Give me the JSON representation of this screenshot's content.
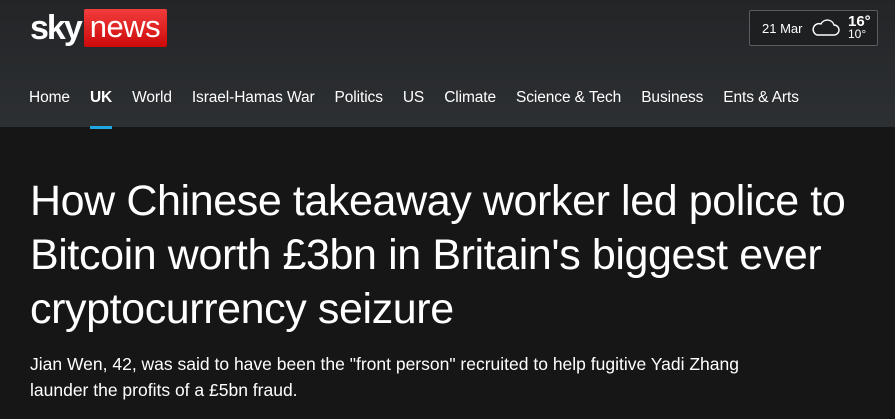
{
  "brand": {
    "logo_sky": "sky",
    "logo_news": "news",
    "accent_red": "#e31b1b",
    "accent_blue": "#1ea7e1"
  },
  "weather": {
    "date": "21 Mar",
    "icon": "cloud-icon",
    "high": "16°",
    "low": "10°"
  },
  "nav": {
    "items": [
      {
        "label": "Home",
        "active": false
      },
      {
        "label": "UK",
        "active": true
      },
      {
        "label": "World",
        "active": false
      },
      {
        "label": "Israel-Hamas War",
        "active": false
      },
      {
        "label": "Politics",
        "active": false
      },
      {
        "label": "US",
        "active": false
      },
      {
        "label": "Climate",
        "active": false
      },
      {
        "label": "Science & Tech",
        "active": false
      },
      {
        "label": "Business",
        "active": false
      },
      {
        "label": "Ents & Arts",
        "active": false
      }
    ]
  },
  "article": {
    "headline": "How Chinese takeaway worker led police to Bitcoin worth £3bn in Britain's biggest ever cryptocurrency seizure",
    "standfirst": "Jian Wen, 42, was said to have been the \"front person\" recruited to help fugitive Yadi Zhang launder the profits of a £5bn fraud."
  }
}
